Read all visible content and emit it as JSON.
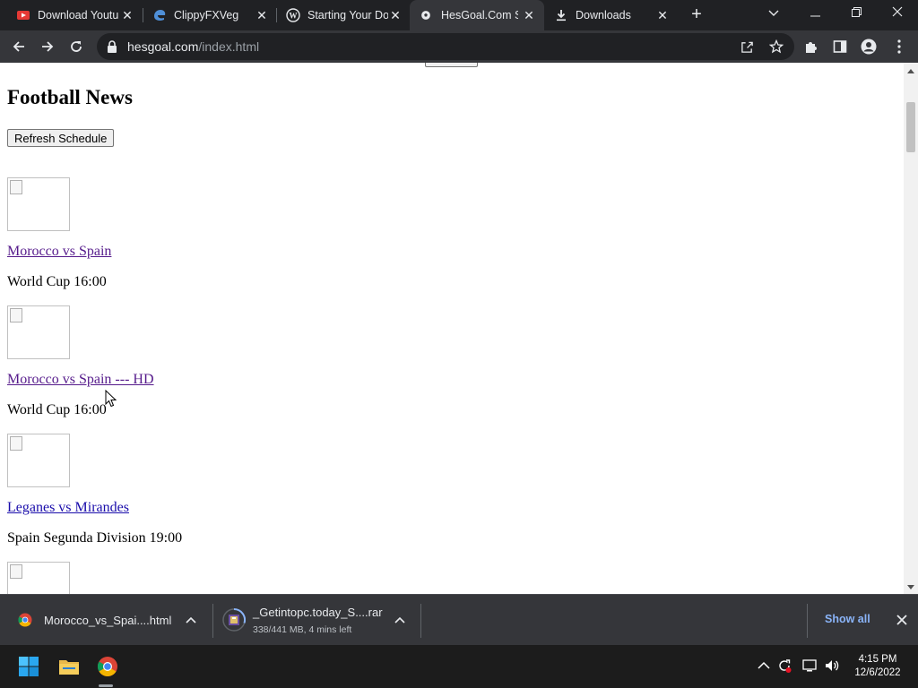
{
  "browser": {
    "tabs": [
      {
        "title": "Download Youtu",
        "favicon": "youtube-red-icon",
        "active": false
      },
      {
        "title": "ClippyFXVeg",
        "favicon": "edge-style-icon",
        "active": false
      },
      {
        "title": "Starting Your Do",
        "favicon": "wordpress-icon",
        "active": false
      },
      {
        "title": "HesGoal.Com Sp",
        "favicon": "soccer-ball-icon",
        "active": true
      },
      {
        "title": "Downloads",
        "favicon": "download-icon",
        "active": false
      }
    ],
    "url_host": "hesgoal.com",
    "url_path": "/index.html"
  },
  "page": {
    "heading": "Football News",
    "refresh_label": "Refresh Schedule",
    "matches": [
      {
        "title": "Morocco vs Spain",
        "info": "World Cup 16:00",
        "visited": true
      },
      {
        "title": "Morocco vs Spain --- HD",
        "info": "World Cup 16:00",
        "visited": true
      },
      {
        "title": "Leganes vs Mirandes",
        "info": "Spain Segunda Division 19:00",
        "visited": false
      },
      {
        "title": "",
        "info": "",
        "visited": false
      }
    ]
  },
  "downloads": {
    "items": [
      {
        "name": "Morocco_vs_Spai....html",
        "status": "",
        "icon": "chrome-icon"
      },
      {
        "name": "_Getintopc.today_S....rar",
        "status": "338/441 MB, 4 mins left",
        "icon": "winrar-archive-icon"
      }
    ],
    "show_all_label": "Show all"
  },
  "taskbar": {
    "time": "4:15 PM",
    "date": "12/6/2022"
  },
  "colors": {
    "tab_bg": "#202124",
    "toolbar_bg": "#35363a",
    "link": "#1a0dab",
    "visited_link": "#551a8b",
    "show_all": "#8ab4f8"
  }
}
